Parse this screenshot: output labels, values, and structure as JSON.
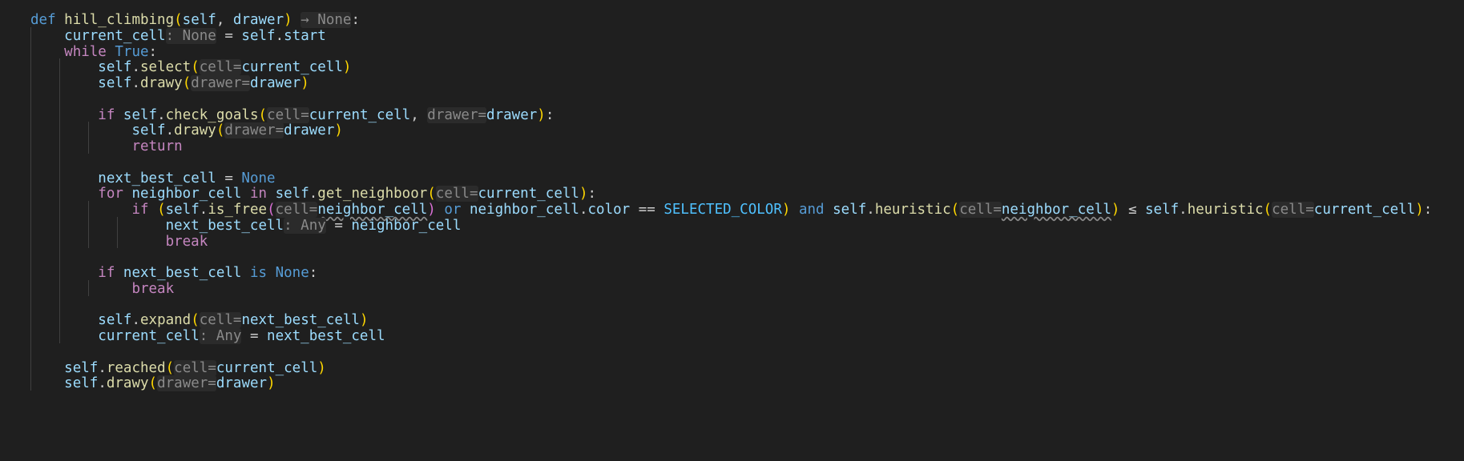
{
  "editor": {
    "colors": {
      "background": "#1f1f1f",
      "keyword": "#569cd6",
      "control": "#c586c0",
      "function": "#dcdcaa",
      "variable": "#9cdcfe",
      "constant": "#4fc1ff",
      "bracket": "#ffd700",
      "bracket_nested": "#da70d6",
      "inlay_hint": "#8a8a8a"
    },
    "lines": [
      [
        [
          "kw",
          "def"
        ],
        [
          "txt",
          " "
        ],
        [
          "fn",
          "hill_climbing"
        ],
        [
          "p1",
          "("
        ],
        [
          "var",
          "self"
        ],
        [
          "txt",
          ", "
        ],
        [
          "var",
          "drawer"
        ],
        [
          "p1",
          ")"
        ],
        [
          "txt",
          " "
        ],
        [
          "hint",
          "→ None"
        ],
        [
          "txt",
          ":"
        ]
      ],
      [
        [
          "txt",
          "    "
        ],
        [
          "var",
          "current_cell"
        ],
        [
          "hint",
          ": None"
        ],
        [
          "txt",
          " = "
        ],
        [
          "var",
          "self"
        ],
        [
          "txt",
          "."
        ],
        [
          "var",
          "start"
        ]
      ],
      [
        [
          "txt",
          "    "
        ],
        [
          "ctl",
          "while"
        ],
        [
          "txt",
          " "
        ],
        [
          "kw",
          "True"
        ],
        [
          "txt",
          ":"
        ]
      ],
      [
        [
          "txt",
          "        "
        ],
        [
          "var",
          "self"
        ],
        [
          "txt",
          "."
        ],
        [
          "fn",
          "select"
        ],
        [
          "p1",
          "("
        ],
        [
          "hint",
          "cell="
        ],
        [
          "var",
          "current_cell"
        ],
        [
          "p1",
          ")"
        ]
      ],
      [
        [
          "txt",
          "        "
        ],
        [
          "var",
          "self"
        ],
        [
          "txt",
          "."
        ],
        [
          "fn",
          "drawy"
        ],
        [
          "p1",
          "("
        ],
        [
          "hint",
          "drawer="
        ],
        [
          "var",
          "drawer"
        ],
        [
          "p1",
          ")"
        ]
      ],
      [],
      [
        [
          "txt",
          "        "
        ],
        [
          "ctl",
          "if"
        ],
        [
          "txt",
          " "
        ],
        [
          "var",
          "self"
        ],
        [
          "txt",
          "."
        ],
        [
          "fn",
          "check_goals"
        ],
        [
          "p1",
          "("
        ],
        [
          "hint",
          "cell="
        ],
        [
          "var",
          "current_cell"
        ],
        [
          "txt",
          ", "
        ],
        [
          "hint",
          "drawer="
        ],
        [
          "var",
          "drawer"
        ],
        [
          "p1",
          ")"
        ],
        [
          "txt",
          ":"
        ]
      ],
      [
        [
          "txt",
          "            "
        ],
        [
          "var",
          "self"
        ],
        [
          "txt",
          "."
        ],
        [
          "fn",
          "drawy"
        ],
        [
          "p1",
          "("
        ],
        [
          "hint",
          "drawer="
        ],
        [
          "var",
          "drawer"
        ],
        [
          "p1",
          ")"
        ]
      ],
      [
        [
          "txt",
          "            "
        ],
        [
          "ctl",
          "return"
        ]
      ],
      [],
      [
        [
          "txt",
          "        "
        ],
        [
          "var",
          "next_best_cell"
        ],
        [
          "txt",
          " = "
        ],
        [
          "kw",
          "None"
        ]
      ],
      [
        [
          "txt",
          "        "
        ],
        [
          "ctl",
          "for"
        ],
        [
          "txt",
          " "
        ],
        [
          "var",
          "neighbor_cell"
        ],
        [
          "txt",
          " "
        ],
        [
          "ctl",
          "in"
        ],
        [
          "txt",
          " "
        ],
        [
          "var",
          "self"
        ],
        [
          "txt",
          "."
        ],
        [
          "fn",
          "get_neighboor"
        ],
        [
          "p1",
          "("
        ],
        [
          "hint",
          "cell="
        ],
        [
          "var",
          "current_cell"
        ],
        [
          "p1",
          ")"
        ],
        [
          "txt",
          ":"
        ]
      ],
      [
        [
          "txt",
          "            "
        ],
        [
          "ctl",
          "if"
        ],
        [
          "txt",
          " "
        ],
        [
          "p1",
          "("
        ],
        [
          "var",
          "self"
        ],
        [
          "txt",
          "."
        ],
        [
          "fn",
          "is_free"
        ],
        [
          "p2",
          "("
        ],
        [
          "hint",
          "cell="
        ],
        [
          "var",
          "neighbor_cell"
        ],
        [
          "p2",
          ")"
        ],
        [
          "txt",
          " "
        ],
        [
          "kw",
          "or"
        ],
        [
          "txt",
          " "
        ],
        [
          "var",
          "neighbor_cell"
        ],
        [
          "txt",
          "."
        ],
        [
          "var",
          "color"
        ],
        [
          "txt",
          " == "
        ],
        [
          "con",
          "SELECTED_COLOR"
        ],
        [
          "p1",
          ")"
        ],
        [
          "txt",
          " "
        ],
        [
          "kw",
          "and"
        ],
        [
          "txt",
          " "
        ],
        [
          "var",
          "self"
        ],
        [
          "txt",
          "."
        ],
        [
          "fn",
          "heuristic"
        ],
        [
          "p1",
          "("
        ],
        [
          "hint",
          "cell="
        ],
        [
          "var",
          "neighbor_cell"
        ],
        [
          "p1",
          ")"
        ],
        [
          "txt",
          " ≤ "
        ],
        [
          "var",
          "self"
        ],
        [
          "txt",
          "."
        ],
        [
          "fn",
          "heuristic"
        ],
        [
          "p1",
          "("
        ],
        [
          "hint",
          "cell="
        ],
        [
          "var",
          "current_cell"
        ],
        [
          "p1",
          ")"
        ],
        [
          "txt",
          ":"
        ]
      ],
      [
        [
          "txt",
          "                "
        ],
        [
          "var",
          "next_best_cell"
        ],
        [
          "hint",
          ": Any"
        ],
        [
          "txt",
          " = "
        ],
        [
          "var",
          "neighbor_cell"
        ]
      ],
      [
        [
          "txt",
          "                "
        ],
        [
          "ctl",
          "break"
        ]
      ],
      [],
      [
        [
          "txt",
          "        "
        ],
        [
          "ctl",
          "if"
        ],
        [
          "txt",
          " "
        ],
        [
          "var",
          "next_best_cell"
        ],
        [
          "txt",
          " "
        ],
        [
          "kw",
          "is"
        ],
        [
          "txt",
          " "
        ],
        [
          "kw",
          "None"
        ],
        [
          "txt",
          ":"
        ]
      ],
      [
        [
          "txt",
          "            "
        ],
        [
          "ctl",
          "break"
        ]
      ],
      [],
      [
        [
          "txt",
          "        "
        ],
        [
          "var",
          "self"
        ],
        [
          "txt",
          "."
        ],
        [
          "fn",
          "expand"
        ],
        [
          "p1",
          "("
        ],
        [
          "hint",
          "cell="
        ],
        [
          "var",
          "next_best_cell"
        ],
        [
          "p1",
          ")"
        ]
      ],
      [
        [
          "txt",
          "        "
        ],
        [
          "var",
          "current_cell"
        ],
        [
          "hint",
          ": Any"
        ],
        [
          "txt",
          " = "
        ],
        [
          "var",
          "next_best_cell"
        ]
      ],
      [],
      [
        [
          "txt",
          "    "
        ],
        [
          "var",
          "self"
        ],
        [
          "txt",
          "."
        ],
        [
          "fn",
          "reached"
        ],
        [
          "p1",
          "("
        ],
        [
          "hint",
          "cell="
        ],
        [
          "var",
          "current_cell"
        ],
        [
          "p1",
          ")"
        ]
      ],
      [
        [
          "txt",
          "    "
        ],
        [
          "var",
          "self"
        ],
        [
          "txt",
          "."
        ],
        [
          "fn",
          "drawy"
        ],
        [
          "p1",
          "("
        ],
        [
          "hint",
          "drawer="
        ],
        [
          "var",
          "drawer"
        ],
        [
          "p1",
          ")"
        ]
      ]
    ]
  }
}
